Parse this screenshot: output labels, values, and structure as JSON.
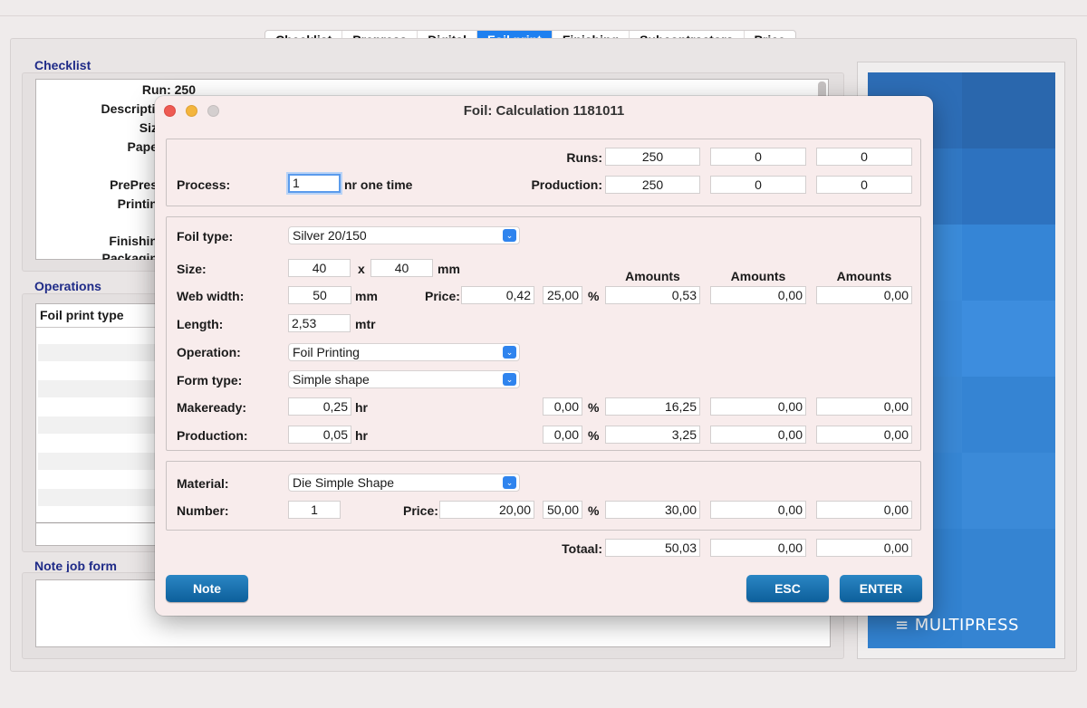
{
  "tabs": [
    "Checklist",
    "Prepress",
    "Digital",
    "Foil print",
    "Finishing",
    "Subcontractors",
    "Price"
  ],
  "active_tab": "Foil print",
  "background": {
    "checklist_title": "Checklist",
    "checklist_rows": [
      "Run: 250",
      "Descriptio",
      "Siz",
      "Pape",
      "PrePres",
      "Printin",
      "Finishin",
      "Packagin"
    ],
    "operations_title": "Operations",
    "operations_header": "Foil print type",
    "note_title": "Note job form",
    "logo_text": "≡ MULTIPRESS"
  },
  "dialog": {
    "title": "Foil: Calculation 1181011",
    "process": {
      "process_label": "Process:",
      "process_value": "1",
      "process_suffix": "nr one time",
      "runs_label": "Runs:",
      "runs": [
        "250",
        "0",
        "0"
      ],
      "production_label": "Production:",
      "production": [
        "250",
        "0",
        "0"
      ]
    },
    "foil": {
      "foil_type_label": "Foil type:",
      "foil_type_value": "Silver 20/150",
      "size_label": "Size:",
      "size_w": "40",
      "size_x": "x",
      "size_h": "40",
      "size_unit": "mm",
      "web_width_label": "Web width:",
      "web_width_value": "50",
      "web_width_unit": "mm",
      "price_label": "Price:",
      "price_value": "0,42",
      "price_pct": "25,00",
      "pct_sign": "%",
      "length_label": "Length:",
      "length_value": "2,53",
      "length_unit": "mtr",
      "operation_label": "Operation:",
      "operation_value": "Foil Printing",
      "form_type_label": "Form type:",
      "form_type_value": "Simple shape",
      "makeready_label": "Makeready:",
      "makeready_value": "0,25",
      "makeready_unit": "hr",
      "makeready_pct": "0,00",
      "production_label": "Production:",
      "production_value": "0,05",
      "production_unit": "hr",
      "production_pct": "0,00",
      "amounts_headers": [
        "Amounts",
        "Amounts",
        "Amounts"
      ],
      "price_amounts": [
        "0,53",
        "0,00",
        "0,00"
      ],
      "makeready_amounts": [
        "16,25",
        "0,00",
        "0,00"
      ],
      "production_amounts": [
        "3,25",
        "0,00",
        "0,00"
      ]
    },
    "material": {
      "material_label": "Material:",
      "material_value": "Die Simple Shape",
      "number_label": "Number:",
      "number_value": "1",
      "price_label": "Price:",
      "price_value": "20,00",
      "price_pct": "50,00",
      "pct_sign": "%",
      "amounts": [
        "30,00",
        "0,00",
        "0,00"
      ]
    },
    "total_label": "Totaal:",
    "totals": [
      "50,03",
      "0,00",
      "0,00"
    ],
    "buttons": {
      "note": "Note",
      "esc": "ESC",
      "enter": "ENTER"
    }
  },
  "colors": {
    "accent_tab": "#1e80f0",
    "section_title": "#1f2b88",
    "button": "#0d5f9b",
    "logo_bg": "#2f7fd0",
    "close": "#ee5b53",
    "minimize": "#f4b53d"
  }
}
